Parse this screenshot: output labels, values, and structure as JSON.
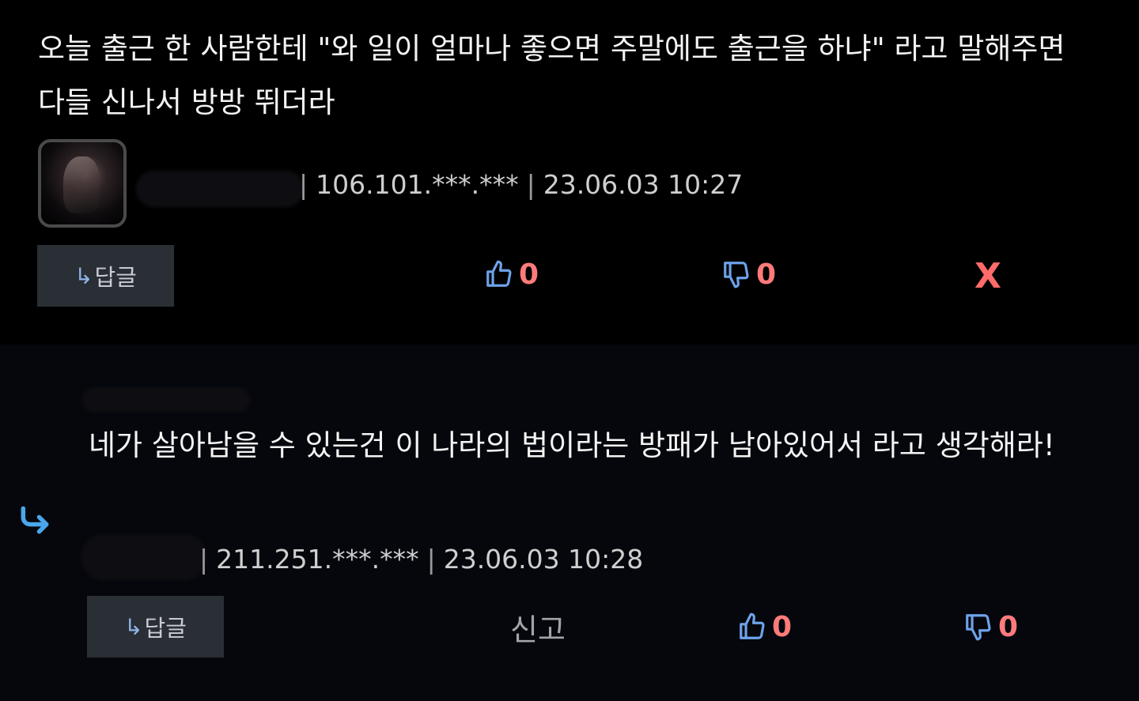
{
  "comment1": {
    "text": "오늘 출근 한 사람한테 \"와 일이 얼마나 좋으면 주말에도 출근을 하냐\" 라고 말해주면 다들 신나서 방방 뛰더라",
    "ip": "106.101.***.***",
    "date": "23.06.03 10:27",
    "reply_label": "답글",
    "reply_arrow": "↳",
    "likes": "0",
    "dislikes": "0",
    "close_label": "X"
  },
  "comment2": {
    "text": "네가 살아남을 수 있는건 이 나라의 법이라는 방패가 남아있어서 라고 생각해라!",
    "ip": "211.251.***.***",
    "date": "23.06.03 10:28",
    "reply_label": "답글",
    "reply_arrow": "↳",
    "report_label": "신고",
    "likes": "0",
    "dislikes": "0"
  },
  "colors": {
    "background": "#000000",
    "reply_background": "#05070d",
    "button_bg": "#2a2e35",
    "count_red": "#ff7b7b",
    "icon_blue": "#6ea2ea",
    "reply_arrow_blue": "#4aa6ea"
  },
  "icons": [
    "thumbs-up-icon",
    "thumbs-down-icon",
    "reply-arrow-icon",
    "close-icon"
  ]
}
